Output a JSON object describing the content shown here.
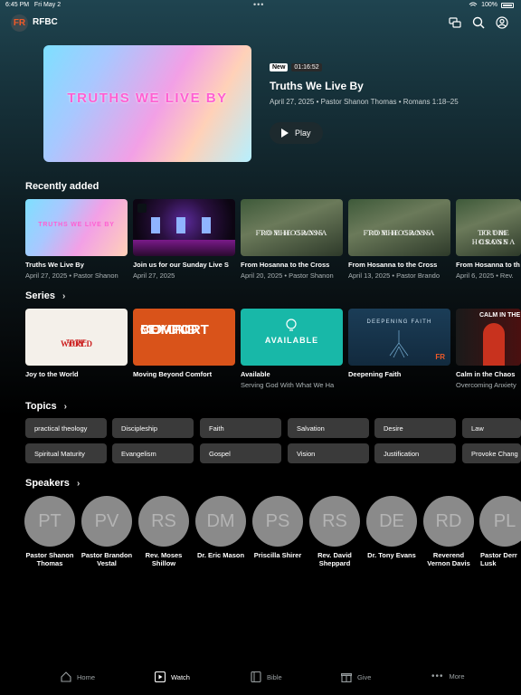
{
  "status": {
    "time": "6:45 PM",
    "date": "Fri May 2",
    "battery": "100%"
  },
  "app": {
    "brand": "RFBC"
  },
  "hero": {
    "art_text": "TRUTHS WE LIVE BY",
    "badge_new": "New",
    "duration": "01:16:52",
    "title": "Truths We Live By",
    "meta": "April 27, 2025 • Pastor Shanon Thomas • Romans 1:18–25",
    "play_label": "Play"
  },
  "recent": {
    "heading": "Recently added",
    "items": [
      {
        "thumb_text": "TRUTHS WE LIVE BY",
        "title": "Truths We Live By",
        "sub": "April 27, 2025 • Pastor Shanon"
      },
      {
        "title": "Join us for our Sunday Live S",
        "sub": "April 27, 2025"
      },
      {
        "thumb_line1": "FROM HOSANNA",
        "thumb_line2": "TO THE CROSS",
        "title": "From Hosanna to the Cross",
        "sub": "April 20, 2025 • Pastor Shanon"
      },
      {
        "thumb_line1": "FROM HOSANNA",
        "thumb_line2": "TO THE CROSS",
        "title": "From Hosanna to the Cross",
        "sub": "April 13, 2025 • Pastor Brando"
      },
      {
        "thumb_line1": "FROM HOSANNA",
        "thumb_line2": "TO THE CROSS",
        "title": "From Hosanna to th",
        "sub": "April 6, 2025 • Rev."
      }
    ]
  },
  "series": {
    "heading": "Series",
    "items": [
      {
        "thumb_line1": "JOY",
        "thumb_line2": "TO THE",
        "thumb_line3": "WORLD",
        "title": "Joy to the World",
        "sub": ""
      },
      {
        "thumb_line1": "MOVING",
        "thumb_line2": "BEYOND",
        "thumb_line3": "COMFORT",
        "title": "Moving Beyond Comfort",
        "sub": ""
      },
      {
        "thumb_text": "AVAILABLE",
        "title": "Available",
        "sub": "Serving God With What We Ha"
      },
      {
        "thumb_text": "DEEPENING FAITH",
        "title": "Deepening Faith",
        "sub": ""
      },
      {
        "thumb_text": "CALM IN THE",
        "title": "Calm in the Chaos",
        "sub": "Overcoming Anxiety"
      }
    ]
  },
  "topics": {
    "heading": "Topics",
    "row1": [
      "practical theology",
      "Discipleship",
      "Faith",
      "Salvation",
      "Desire",
      "Law"
    ],
    "row2": [
      "Spiritual Maturity",
      "Evangelism",
      "Gospel",
      "Vision",
      "Justification",
      "Provoke Chang"
    ]
  },
  "speakers": {
    "heading": "Speakers",
    "items": [
      {
        "initials": "PT",
        "name": "Pastor Shanon Thomas"
      },
      {
        "initials": "PV",
        "name": "Pastor Brandon Vestal"
      },
      {
        "initials": "RS",
        "name": "Rev. Moses Shillow"
      },
      {
        "initials": "DM",
        "name": "Dr. Eric Mason"
      },
      {
        "initials": "PS",
        "name": "Priscilla Shirer"
      },
      {
        "initials": "RS",
        "name": "Rev. David Sheppard"
      },
      {
        "initials": "DE",
        "name": "Dr. Tony Evans"
      },
      {
        "initials": "RD",
        "name": "Reverend Vernon Davis"
      },
      {
        "initials": "PL",
        "name": "Pastor Derr Lusk"
      }
    ]
  },
  "tabs": [
    "Home",
    "Watch",
    "Bible",
    "Give",
    "More"
  ],
  "active_tab": "Watch",
  "colors": {
    "accent_logo": "#f05a28",
    "chip_bg": "#3a3a3a",
    "avatar_bg": "#8a8a8a"
  }
}
